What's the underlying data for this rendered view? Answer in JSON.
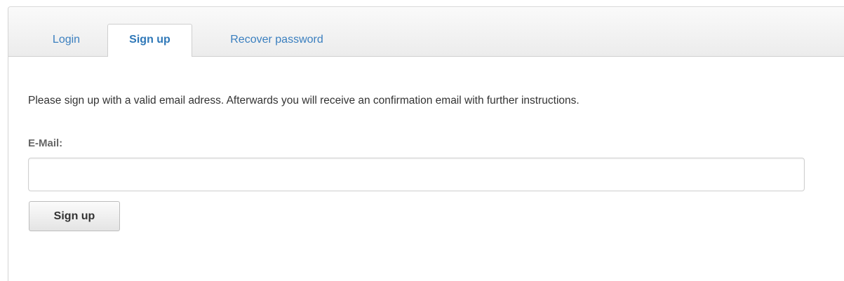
{
  "tabs": {
    "login": "Login",
    "signup": "Sign up",
    "recover": "Recover password",
    "active": "signup"
  },
  "form": {
    "instructions": "Please sign up with a valid email adress. Afterwards you will receive an confirmation email with further instructions.",
    "email_label": "E-Mail:",
    "email_value": "",
    "submit_label": "Sign up"
  },
  "colors": {
    "tab_text": "#3a7fbf",
    "body_text": "#333333",
    "label_text": "#666666"
  }
}
